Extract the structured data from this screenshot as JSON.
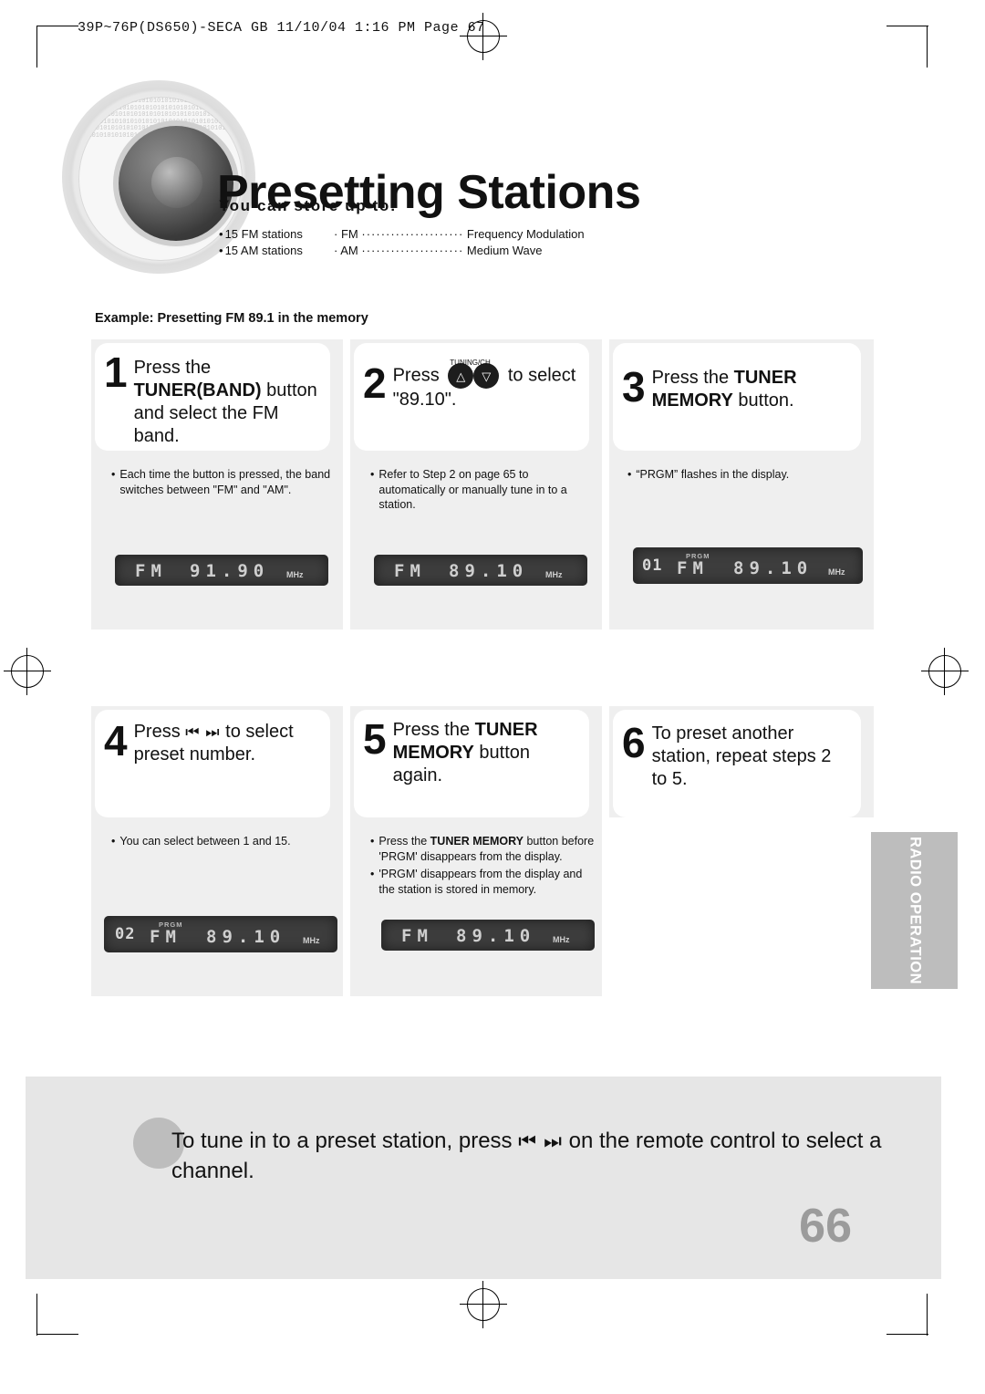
{
  "header": {
    "filename_line": "39P~76P(DS650)-SECA GB   11/10/04 1:16 PM   Page 67"
  },
  "title": "Presetting Stations",
  "store_section": {
    "heading": "You can store up to:",
    "rows": [
      {
        "bullet": "•",
        "left": "15 FM stations",
        "right_bullet": "·",
        "right_label": "FM",
        "dots": "·····················",
        "right_value": "Frequency Modulation"
      },
      {
        "bullet": "•",
        "left": "15 AM stations",
        "right_bullet": "·",
        "right_label": "AM",
        "dots": "·····················",
        "right_value": "Medium Wave"
      }
    ]
  },
  "example_caption": "Example: Presetting FM 89.1 in the memory",
  "steps": [
    {
      "number": "1",
      "text_html": "Press the <b>TUNER(BAND)</b> button  and select the FM band.",
      "bullets": [
        "Each time the button is pressed, the band switches between \"FM\" and \"AM\"."
      ],
      "display": {
        "prgm": "",
        "preset": "",
        "band": "FM",
        "freq": "91.90",
        "unit": "MHz"
      }
    },
    {
      "number": "2",
      "text_before": "Press",
      "text_after": "to select \"89.10\".",
      "knob_label": "TUNING/CH",
      "bullets": [
        "Refer to Step 2 on page 65 to automatically or manually tune in to a station."
      ],
      "display": {
        "prgm": "",
        "preset": "",
        "band": "FM",
        "freq": "89.10",
        "unit": "MHz"
      }
    },
    {
      "number": "3",
      "text_html": "Press the <b>TUNER MEMORY</b> button.",
      "bullets": [
        "“PRGM” flashes in the display."
      ],
      "display": {
        "prgm": "PRGM",
        "preset": "01",
        "band": "FM",
        "freq": "89.10",
        "unit": "MHz"
      }
    },
    {
      "number": "4",
      "text_before": "Press",
      "text_after": "to select preset number.",
      "skip_icon": "⏮ ⏭",
      "bullets": [
        "You can select between 1 and 15."
      ],
      "display": {
        "prgm": "PRGM",
        "preset": "02",
        "band": "FM",
        "freq": "89.10",
        "unit": "MHz"
      }
    },
    {
      "number": "5",
      "text_html": "Press the <b>TUNER MEMORY</b> button again.",
      "bullets_html": [
        "Press the <b>TUNER MEMORY</b> button before 'PRGM' disappears from the display.",
        "'PRGM' disappears from the display and the station is stored in memory."
      ],
      "display": {
        "prgm": "",
        "preset": "",
        "band": "FM",
        "freq": "89.10",
        "unit": "MHz"
      }
    },
    {
      "number": "6",
      "text_html": "To preset another station, repeat steps 2 to 5.",
      "bullets": [],
      "display": null
    }
  ],
  "side_tab": "RADIO OPERATION",
  "bottom_note": {
    "text_before": "To tune in to a preset station, press",
    "skip_icon": "⏮ ⏭",
    "text_after": "on the remote control to select a channel."
  },
  "page_number": "66",
  "colors": {
    "card_bg": "#efefef",
    "lcd_bg": "#3d3d3d",
    "side_tab": "#bdbdbd",
    "note_bg": "#e6e6e6",
    "page_number": "#9b9b9b"
  }
}
